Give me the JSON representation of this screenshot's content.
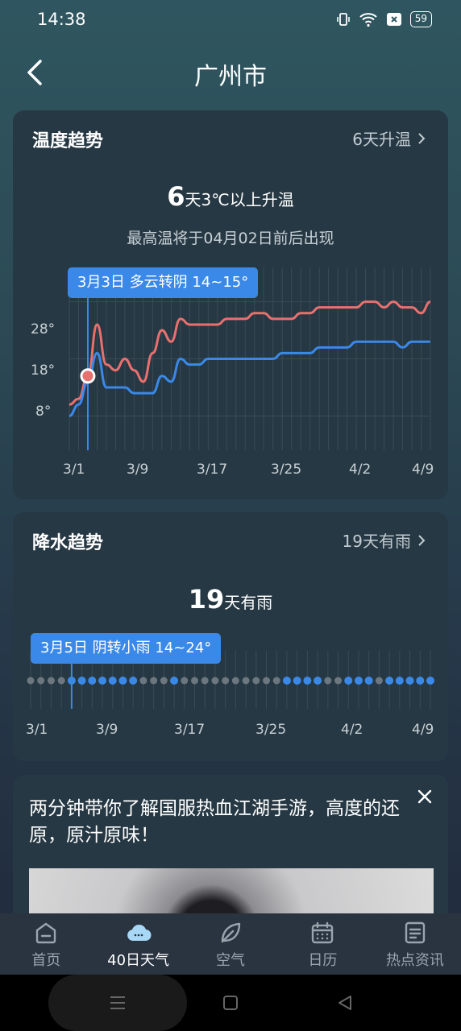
{
  "status": {
    "time": "14:38",
    "battery": "59"
  },
  "header": {
    "city": "广州市"
  },
  "temp_card": {
    "title": "温度趋势",
    "link": "6天升温",
    "big_number": "6",
    "big_text": "天3℃以上升温",
    "sub_text": "最高温将于04月02日前后出现",
    "tooltip": "3月3日 多云转阴 14~15°",
    "y_labels": [
      "28°",
      "18°",
      "8°"
    ],
    "x_labels": [
      "3/1",
      "3/9",
      "3/17",
      "3/25",
      "4/2",
      "4/9"
    ]
  },
  "rain_card": {
    "title": "降水趋势",
    "link": "19天有雨",
    "big_number": "19",
    "big_text": "天有雨",
    "tooltip": "3月5日 阴转小雨 14~24°",
    "x_labels": [
      "3/1",
      "3/9",
      "3/17",
      "3/25",
      "4/2",
      "4/9"
    ]
  },
  "ad": {
    "text": "两分钟带你了解国服热血江湖手游，高度的还原，原汁原味！"
  },
  "tabs": [
    {
      "label": "首页",
      "icon": "home-icon"
    },
    {
      "label": "40日天气",
      "icon": "cloud-icon"
    },
    {
      "label": "空气",
      "icon": "leaf-icon"
    },
    {
      "label": "日历",
      "icon": "calendar-icon"
    },
    {
      "label": "热点资讯",
      "icon": "news-icon"
    }
  ],
  "colors": {
    "high_line": "#e8706f",
    "low_line": "#3a89e8",
    "rain_dot": "#3a89e8",
    "dry_dot": "#6c7780"
  },
  "chart_data": [
    {
      "type": "line",
      "x": [
        "3/1",
        "3/2",
        "3/3",
        "3/4",
        "3/5",
        "3/6",
        "3/7",
        "3/8",
        "3/9",
        "3/10",
        "3/11",
        "3/12",
        "3/13",
        "3/14",
        "3/15",
        "3/16",
        "3/17",
        "3/18",
        "3/19",
        "3/20",
        "3/21",
        "3/22",
        "3/23",
        "3/24",
        "3/25",
        "3/26",
        "3/27",
        "3/28",
        "3/29",
        "3/30",
        "3/31",
        "4/1",
        "4/2",
        "4/3",
        "4/4",
        "4/5",
        "4/6",
        "4/7",
        "4/8",
        "4/9"
      ],
      "series": [
        {
          "values": [
            10,
            11,
            15,
            24,
            17,
            16,
            18,
            16,
            14,
            19,
            23,
            21,
            25,
            24,
            24,
            24,
            24,
            25,
            25,
            25,
            26,
            26,
            25,
            25,
            25,
            26,
            26,
            27,
            27,
            27,
            27,
            27,
            28,
            28,
            27,
            28,
            27,
            27,
            26,
            28
          ]
        },
        {
          "values": [
            8,
            10,
            14,
            19,
            13,
            13,
            13,
            12,
            12,
            12,
            15,
            14,
            18,
            17,
            17,
            18,
            18,
            18,
            18,
            18,
            18,
            18,
            18,
            19,
            19,
            19,
            19,
            20,
            20,
            20,
            20,
            21,
            21,
            21,
            21,
            21,
            20,
            21,
            21,
            21
          ]
        }
      ],
      "ylim": [
        2,
        34
      ]
    },
    {
      "type": "scatter",
      "x": [
        "3/1",
        "3/2",
        "3/3",
        "3/4",
        "3/5",
        "3/6",
        "3/7",
        "3/8",
        "3/9",
        "3/10",
        "3/11",
        "3/12",
        "3/13",
        "3/14",
        "3/15",
        "3/16",
        "3/17",
        "3/18",
        "3/19",
        "3/20",
        "3/21",
        "3/22",
        "3/23",
        "3/24",
        "3/25",
        "3/26",
        "3/27",
        "3/28",
        "3/29",
        "3/30",
        "3/31",
        "4/1",
        "4/2",
        "4/3",
        "4/4",
        "4/5",
        "4/6",
        "4/7",
        "4/8",
        "4/9"
      ],
      "rain": [
        0,
        0,
        0,
        0,
        1,
        1,
        1,
        1,
        1,
        1,
        1,
        0,
        0,
        0,
        1,
        0,
        0,
        0,
        0,
        0,
        0,
        0,
        0,
        0,
        0,
        1,
        1,
        1,
        1,
        0,
        0,
        1,
        1,
        1,
        0,
        1,
        1,
        1,
        1,
        1
      ]
    }
  ]
}
